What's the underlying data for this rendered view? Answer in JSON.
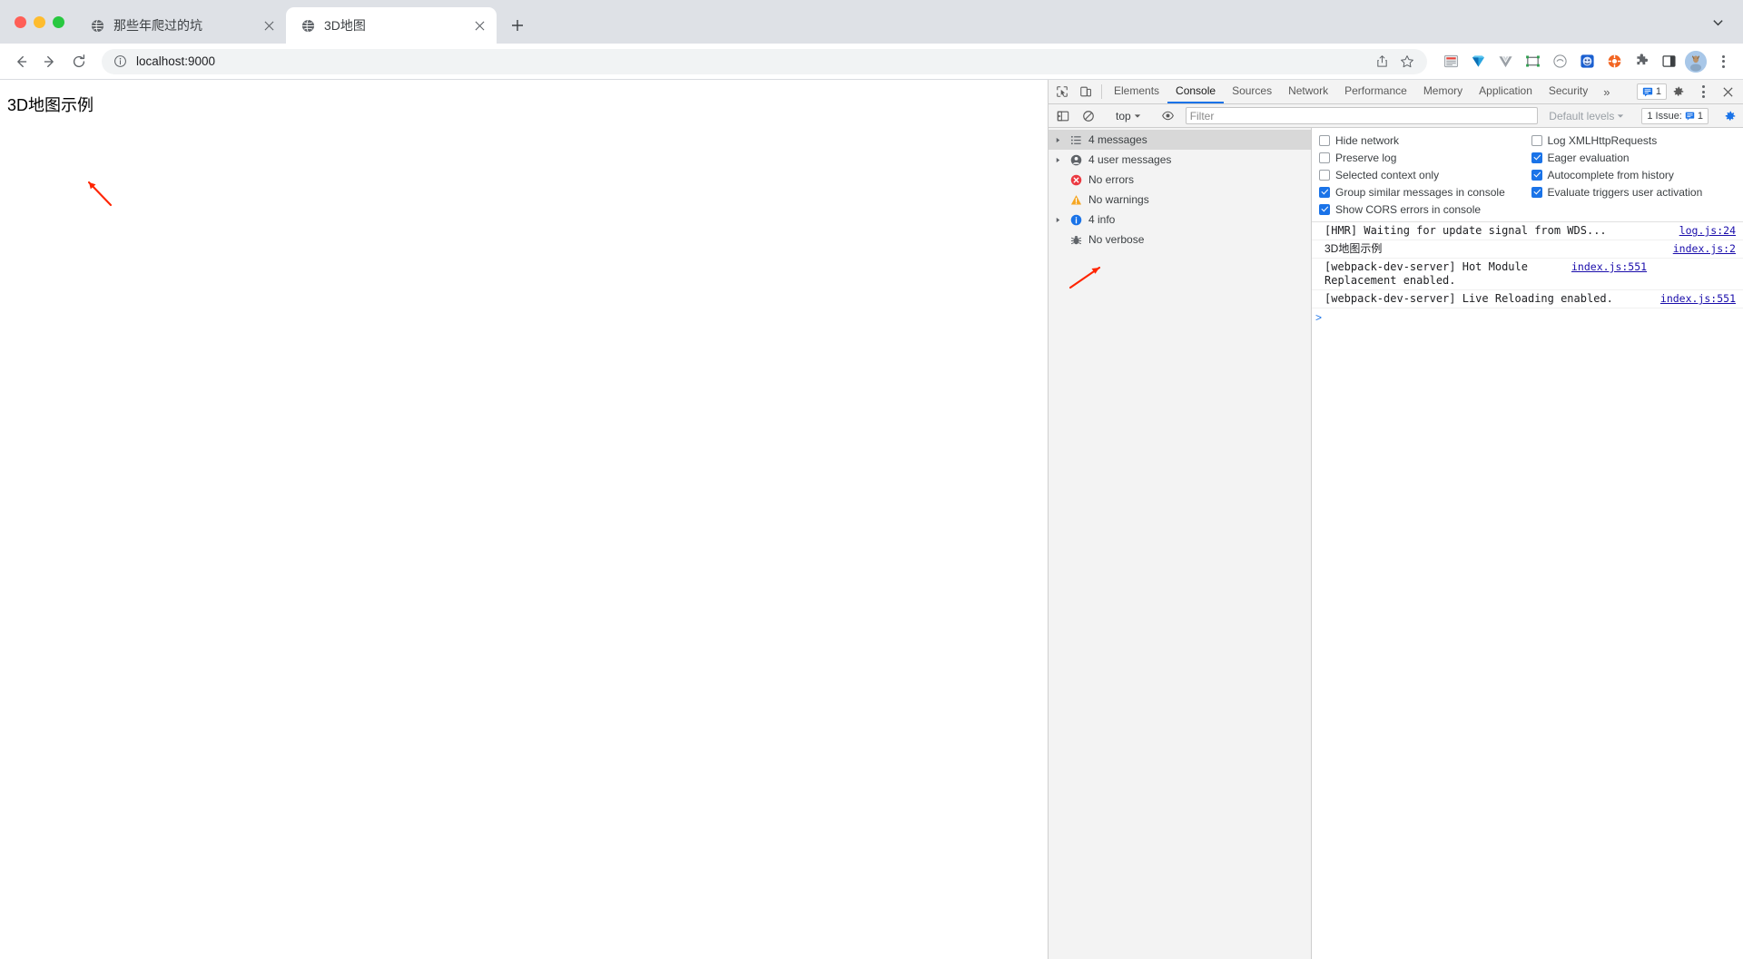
{
  "window": {
    "traffic_lights": [
      "close",
      "minimize",
      "maximize"
    ]
  },
  "tabs": [
    {
      "title": "那些年爬过的坑",
      "active": false,
      "favicon": "globe-icon",
      "close": "×"
    },
    {
      "title": "3D地图",
      "active": true,
      "favicon": "globe-icon",
      "close": "×"
    }
  ],
  "tabstrip": {
    "new_tab_label": "+",
    "tab_search": "chevron-down-icon"
  },
  "toolbar": {
    "back": "←",
    "forward": "→",
    "reload": "⟳",
    "url": "localhost:9000",
    "info_icon": "info-circle-icon",
    "share_icon": "share-icon",
    "bookmark_icon": "star-icon",
    "extensions": [
      "notes-extension-icon",
      "diamond-extension-icon",
      "vue-devtools-icon",
      "screenshot-extension-icon",
      "clock-extension-icon",
      "blue-face-extension-icon",
      "orange-circle-extension-icon",
      "puzzle-icon",
      "sidepanel-icon"
    ],
    "avatar": "profile-avatar",
    "menu": "kebab-menu-icon"
  },
  "page": {
    "heading": "3D地图示例",
    "annotation_arrow": "red-arrow-annotation"
  },
  "devtools": {
    "left_icons": [
      "inspect-element-icon",
      "device-toolbar-icon"
    ],
    "tabs": [
      {
        "label": "Elements",
        "active": false
      },
      {
        "label": "Console",
        "active": true
      },
      {
        "label": "Sources",
        "active": false
      },
      {
        "label": "Network",
        "active": false
      },
      {
        "label": "Performance",
        "active": false
      },
      {
        "label": "Memory",
        "active": false
      },
      {
        "label": "Application",
        "active": false
      },
      {
        "label": "Security",
        "active": false
      }
    ],
    "more_tabs": "»",
    "issue_badge_count": "1",
    "settings_icon": "gear-icon",
    "kebab_icon": "kebab-menu-icon",
    "close_icon": "close-icon",
    "filterbar": {
      "sidebar_toggle": "console-sidebar-toggle-icon",
      "clear_console": "clear-console-icon",
      "context": "top",
      "eye_icon": "live-expression-icon",
      "filter_placeholder": "Filter",
      "filter_value": "",
      "levels": "Default levels",
      "issue_label": "1 Issue:",
      "issue_count": "1",
      "settings_gear": "console-settings-gear-icon"
    },
    "sidebar": [
      {
        "label": "4 messages",
        "icon": "list-icon",
        "twisty": true,
        "selected": true
      },
      {
        "label": "4 user messages",
        "icon": "user-icon",
        "twisty": true,
        "selected": false
      },
      {
        "label": "No errors",
        "icon": "error-icon",
        "twisty": false,
        "selected": false
      },
      {
        "label": "No warnings",
        "icon": "warning-icon",
        "twisty": false,
        "selected": false
      },
      {
        "label": "4 info",
        "icon": "info-icon",
        "twisty": true,
        "selected": false
      },
      {
        "label": "No verbose",
        "icon": "bug-icon",
        "twisty": false,
        "selected": false
      }
    ],
    "settings": {
      "left_column": [
        {
          "label": "Hide network",
          "checked": false
        },
        {
          "label": "Preserve log",
          "checked": false
        },
        {
          "label": "Selected context only",
          "checked": false
        },
        {
          "label": "Group similar messages in console",
          "checked": true
        },
        {
          "label": "Show CORS errors in console",
          "checked": true
        }
      ],
      "right_column": [
        {
          "label": "Log XMLHttpRequests",
          "checked": false
        },
        {
          "label": "Eager evaluation",
          "checked": true
        },
        {
          "label": "Autocomplete from history",
          "checked": true
        },
        {
          "label": "Evaluate triggers user activation",
          "checked": true
        }
      ]
    },
    "messages": [
      {
        "text": "[HMR] Waiting for update signal from WDS...",
        "source": "log.js:24",
        "cjk": false
      },
      {
        "text": "3D地图示例",
        "source": "index.js:2",
        "cjk": true
      },
      {
        "text": "[webpack-dev-server] Hot Module Replacement enabled.",
        "source": "index.js:551",
        "cjk": false
      },
      {
        "text": "[webpack-dev-server] Live Reloading enabled.",
        "source": "index.js:551",
        "cjk": false
      }
    ],
    "prompt": ">",
    "annotation_arrow": "red-arrow-annotation"
  },
  "colors": {
    "accent": "#1a73e8",
    "tabstrip_bg": "#dee1e6",
    "devtools_bg": "#f3f3f3",
    "error": "#eb3941",
    "warning": "#f5a623",
    "link": "#1a0dab",
    "annotation": "#ff2400"
  }
}
